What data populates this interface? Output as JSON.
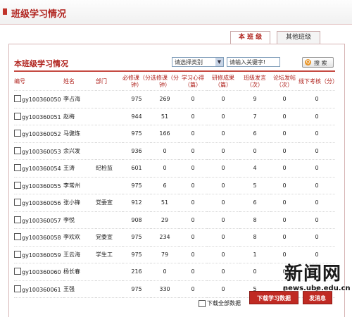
{
  "header": {
    "title": "班级学习情况"
  },
  "tabs": [
    {
      "label": "本 班 级"
    },
    {
      "label": "其他班级"
    }
  ],
  "section": {
    "title": "本班级学习情况"
  },
  "filter": {
    "category_value": "请选择类别",
    "keyword_value": "请输入关键字!",
    "search_label": "搜 索"
  },
  "table": {
    "headers": [
      "编号",
      "姓名",
      "部门",
      "必修课（分钟）",
      "选修课（分钟）",
      "学习心得（篇）",
      "研修成果（篇）",
      "班级发言（次）",
      "论坛发帖（次）",
      "线下考核（分）"
    ],
    "rows": [
      [
        "gy100360050",
        "李占海",
        "",
        "975",
        "269",
        "0",
        "0",
        "9",
        "0",
        "0"
      ],
      [
        "gy100360051",
        "赵梅",
        "",
        "944",
        "51",
        "0",
        "0",
        "7",
        "0",
        "0"
      ],
      [
        "gy100360052",
        "马健炼",
        "",
        "975",
        "166",
        "0",
        "0",
        "6",
        "0",
        "0"
      ],
      [
        "gy100360053",
        "余兴发",
        "",
        "936",
        "0",
        "0",
        "0",
        "0",
        "0",
        "0"
      ],
      [
        "gy100360054",
        "王涛",
        "纪检监",
        "601",
        "0",
        "0",
        "0",
        "4",
        "0",
        "0"
      ],
      [
        "gy100360055",
        "李常州",
        "",
        "975",
        "6",
        "0",
        "0",
        "5",
        "0",
        "0"
      ],
      [
        "gy100360056",
        "张小锋",
        "党委宣",
        "912",
        "51",
        "0",
        "0",
        "6",
        "0",
        "0"
      ],
      [
        "gy100360057",
        "李悦",
        "",
        "908",
        "29",
        "0",
        "0",
        "8",
        "0",
        "0"
      ],
      [
        "gy100360058",
        "李欢欢",
        "党委宣",
        "975",
        "234",
        "0",
        "0",
        "8",
        "0",
        "0"
      ],
      [
        "gy100360059",
        "王云海",
        "学生工",
        "975",
        "79",
        "0",
        "0",
        "1",
        "0",
        "0"
      ],
      [
        "gy100360060",
        "杨长春",
        "",
        "216",
        "0",
        "0",
        "0",
        "0",
        "0",
        "0"
      ],
      [
        "gy100360061",
        "王强",
        "",
        "975",
        "330",
        "0",
        "0",
        "5",
        "0",
        "0"
      ]
    ]
  },
  "footer": {
    "download_all_label": "下载全部数据",
    "download_button": "下载学习数据",
    "send_button": "发消息"
  },
  "watermark": {
    "logo_text": "新闻网",
    "url": "news.ube.edu.cn"
  },
  "colors": {
    "accent": "#b0221d",
    "button_red": "#c02a23"
  }
}
